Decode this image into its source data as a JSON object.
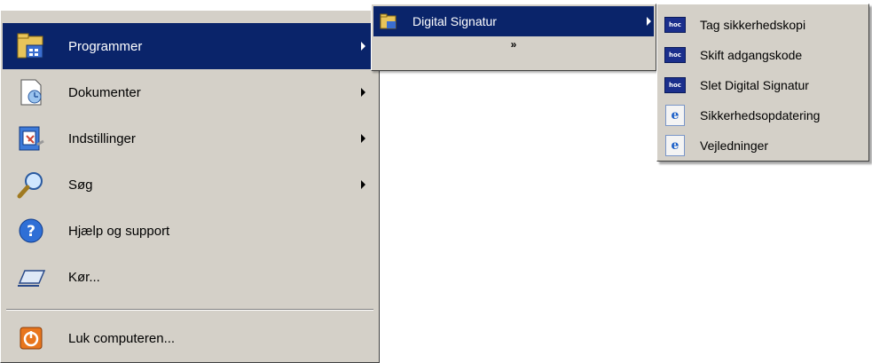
{
  "main_menu": {
    "items": [
      {
        "label": "Programmer",
        "icon": "programs-folder-icon",
        "has_submenu": true,
        "active": true
      },
      {
        "label": "Dokumenter",
        "icon": "documents-icon",
        "has_submenu": true
      },
      {
        "label": "Indstillinger",
        "icon": "settings-icon",
        "has_submenu": true
      },
      {
        "label": "Søg",
        "icon": "search-magnifier-icon",
        "has_submenu": true
      },
      {
        "label": "Hjælp og support",
        "icon": "help-icon",
        "has_submenu": false
      },
      {
        "label": "Kør...",
        "icon": "run-icon",
        "has_submenu": false
      },
      {
        "label": "Luk computeren...",
        "icon": "shutdown-icon",
        "has_submenu": false
      }
    ]
  },
  "programs_submenu": {
    "items": [
      {
        "label": "Digital Signatur",
        "icon": "program-group-icon",
        "has_submenu": true,
        "active": true
      }
    ],
    "expand_glyph": "»"
  },
  "signature_submenu": {
    "items": [
      {
        "label": "Tag sikkerhedskopi",
        "icon": "hoc-app-icon"
      },
      {
        "label": "Skift adgangskode",
        "icon": "hoc-app-icon"
      },
      {
        "label": "Slet Digital Signatur",
        "icon": "hoc-app-icon"
      },
      {
        "label": "Sikkerhedsopdatering",
        "icon": "ie-shortcut-icon"
      },
      {
        "label": "Vejledninger",
        "icon": "ie-shortcut-icon"
      }
    ],
    "app_icon_text": "hoc"
  },
  "colors": {
    "menu_bg": "#d4d0c8",
    "highlight_bg": "#0a246a",
    "highlight_text": "#ffffff"
  }
}
